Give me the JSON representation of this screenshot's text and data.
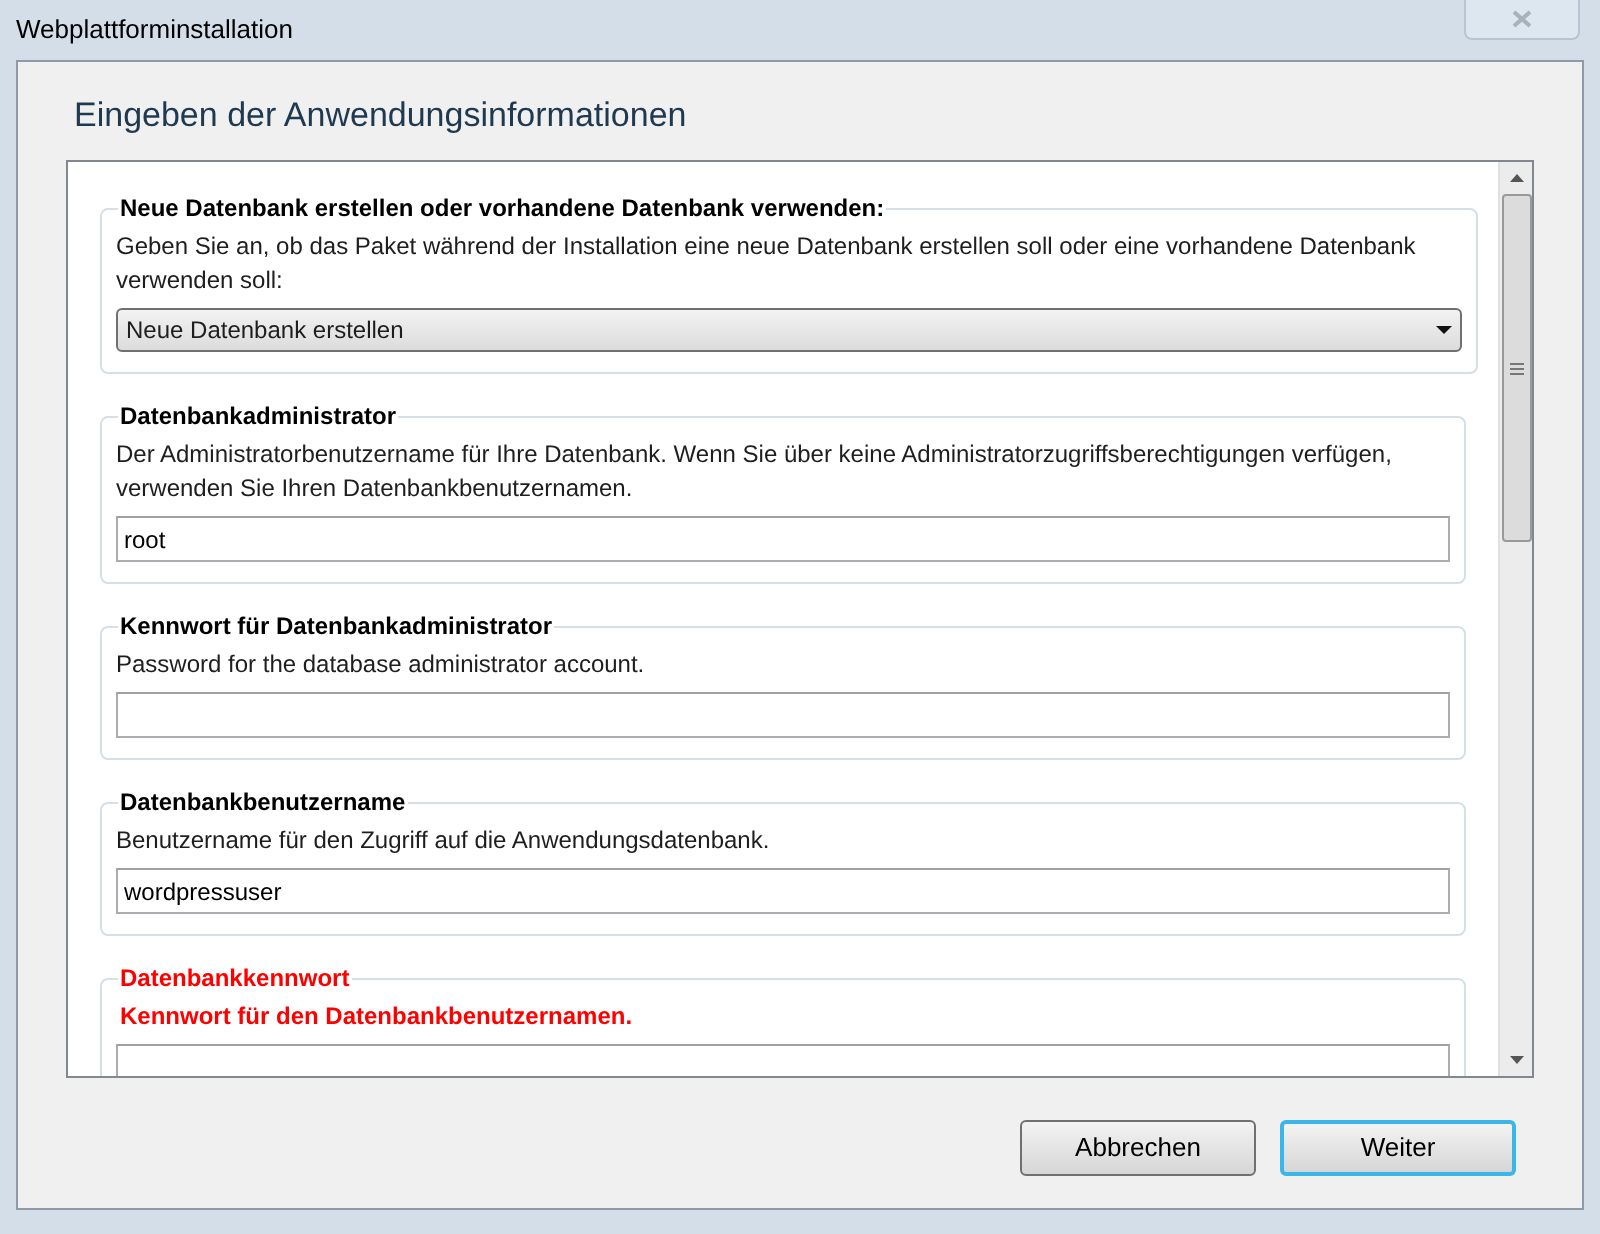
{
  "window": {
    "title": "Webplattforminstallation"
  },
  "heading": "Eingeben der Anwendungsinformationen",
  "sections": [
    {
      "kind": "select",
      "title": "Neue Datenbank erstellen oder vorhandene Datenbank verwenden:",
      "description": "Geben Sie an, ob das Paket während der Installation eine neue Datenbank erstellen soll oder eine vorhandene Datenbank verwenden soll:",
      "value": "Neue Datenbank erstellen",
      "error": false
    },
    {
      "kind": "text",
      "title": "Datenbankadministrator",
      "description": "Der Administratorbenutzername für Ihre Datenbank. Wenn Sie über keine Administratorzugriffsberechtigungen verfügen, verwenden Sie Ihren Datenbankbenutzernamen.",
      "value": "root",
      "error": false
    },
    {
      "kind": "text",
      "title": "Kennwort für Datenbankadministrator",
      "description": "Password for the database administrator account.",
      "error": false
    },
    {
      "kind": "text",
      "title": "Datenbankbenutzername",
      "description": "Benutzername für den Zugriff auf die Anwendungsdatenbank.",
      "value": "wordpressuser",
      "error": false
    },
    {
      "kind": "text",
      "title": "Datenbankkennwort",
      "description": "Kennwort für den Datenbankbenutzernamen.",
      "error": true
    }
  ],
  "buttons": [
    {
      "label": "Abbrechen",
      "default": false
    },
    {
      "label": "Weiter",
      "default": true
    }
  ]
}
